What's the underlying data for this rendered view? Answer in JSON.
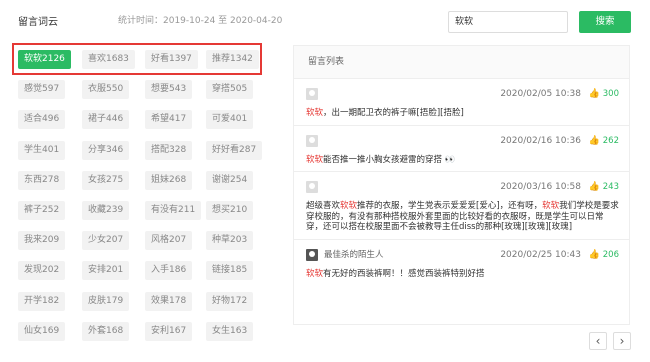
{
  "header": {
    "title": "留言词云",
    "stats": "统计时间：2019-10-24 至 2020-04-20",
    "search_value": "软软",
    "search_button": "搜索"
  },
  "tags": [
    [
      "软软2126",
      "喜欢1683",
      "好看1397",
      "推荐1342"
    ],
    [
      "感觉597",
      "衣服550",
      "想要543",
      "穿搭505"
    ],
    [
      "适合496",
      "裙子446",
      "希望417",
      "可爱401"
    ],
    [
      "学生401",
      "分享346",
      "搭配328",
      "好好看287"
    ],
    [
      "东西278",
      "女孩275",
      "姐妹268",
      "谢谢254"
    ],
    [
      "裤子252",
      "收藏239",
      "有没有211",
      "想买210"
    ],
    [
      "我来209",
      "少女207",
      "风格207",
      "种草203"
    ],
    [
      "发现202",
      "安排201",
      "入手186",
      "链接185"
    ],
    [
      "开学182",
      "皮肤179",
      "效果178",
      "好物172"
    ],
    [
      "仙女169",
      "外套168",
      "安利167",
      "女生163"
    ]
  ],
  "panel": {
    "title": "留言列表",
    "messages": [
      {
        "author": "",
        "time": "2020/02/05 10:38",
        "likes": "300",
        "keyword": "软软",
        "text": "，出一期配卫衣的裤子嘛[捂脸][捂脸]"
      },
      {
        "author": "",
        "time": "2020/02/16 10:36",
        "likes": "262",
        "keyword": "软软",
        "text": "能否推一推小胸女孩避雷的穿搭 👀"
      },
      {
        "author": "",
        "time": "2020/03/16 10:58",
        "likes": "243",
        "text_parts": [
          "超级喜欢",
          "软软",
          "推荐的衣服，学生党表示爱爱爱[爱心]，还有呀，",
          "软软",
          "我们学校是要求穿校服的，有没有那种搭校服外套里面的比较好看的衣服呀，既是学生可以日常穿，还可以搭在校服里面不会被教导主任diss的那种[玫瑰][玫瑰][玫瑰]"
        ]
      },
      {
        "author": "最佳杀的陌生人",
        "time": "2020/02/25 10:43",
        "likes": "206",
        "keyword": "软软",
        "text": "有无好的西装裤啊！！感觉西装裤特别好搭"
      }
    ]
  },
  "pager": {
    "prev": "‹",
    "next": "›"
  },
  "colors": {
    "accent": "#2bbb63",
    "keyword": "#e53935",
    "highlight": "#e53935"
  }
}
